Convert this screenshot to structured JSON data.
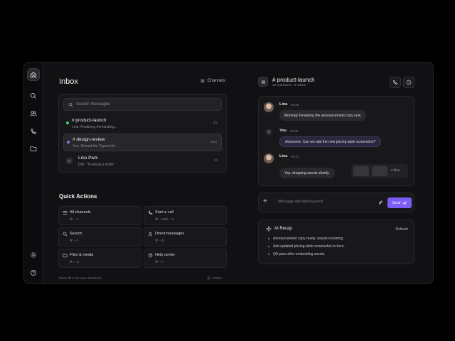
{
  "colors": {
    "accent": "#7c5cf5",
    "online": "#3ecf6e",
    "mention": "#8b7cf5",
    "bg": "#111113"
  },
  "rail": {
    "items": [
      {
        "icon": "home-icon",
        "active": true
      },
      {
        "icon": "search-icon"
      },
      {
        "icon": "users-icon"
      },
      {
        "icon": "phone-icon"
      },
      {
        "icon": "folder-icon"
      }
    ],
    "bottom": [
      {
        "icon": "gear-icon"
      },
      {
        "icon": "help-icon"
      }
    ]
  },
  "inbox": {
    "title": "Inbox",
    "channels_label": "Channels",
    "search_placeholder": "Search messages",
    "conversations": [
      {
        "name": "# product-launch",
        "preview": "Lina: Finalizing the landing...",
        "time": "2m"
      },
      {
        "name": "# design-review",
        "preview": "You: Shared the Figma link",
        "time": "15m"
      },
      {
        "name": "Lina Park",
        "preview": "DM · \"Pushing a hotfix\"",
        "time": "1h",
        "avatar": "LP"
      }
    ]
  },
  "quick_actions": {
    "title": "Quick Actions",
    "items": [
      {
        "label": "All channels",
        "shortcut": "⌘ + K",
        "icon": "list-icon"
      },
      {
        "label": "Start a call",
        "shortcut": "⌘ + Shift + C",
        "icon": "phone-icon"
      },
      {
        "label": "Search",
        "shortcut": "⌘ + F",
        "icon": "search-icon"
      },
      {
        "label": "Direct messages",
        "shortcut": "⌘ + D",
        "icon": "user-icon"
      },
      {
        "label": "Files & media",
        "shortcut": "⌘ + U",
        "icon": "folder-icon"
      },
      {
        "label": "Help center",
        "shortcut": "⌘ + ?",
        "icon": "help-icon"
      }
    ]
  },
  "footer": {
    "hint": "Press ⌘ K for more shortcuts",
    "status": "Online"
  },
  "channel": {
    "name": "# product-launch",
    "meta": "42 members · 6 online"
  },
  "messages": [
    {
      "author": "Lina",
      "time": "09:28",
      "text": "Morning! Finalizing the announcement copy now."
    },
    {
      "author": "You",
      "time": "09:30",
      "text": "Awesome. Can we add the new pricing table screenshot?"
    },
    {
      "author": "Lina",
      "time": "09:31",
      "text": "Yep, dropping assets shortly.",
      "attachments_more": "2 files"
    }
  ],
  "composer": {
    "placeholder": "Message #product-launch",
    "send_label": "Send"
  },
  "recap": {
    "title": "AI Recap",
    "refresh_label": "Refresh",
    "items": [
      "Announcement copy ready; assets incoming.",
      "Add updated pricing table screenshot to hero.",
      "QA pass after embedding assets."
    ]
  }
}
